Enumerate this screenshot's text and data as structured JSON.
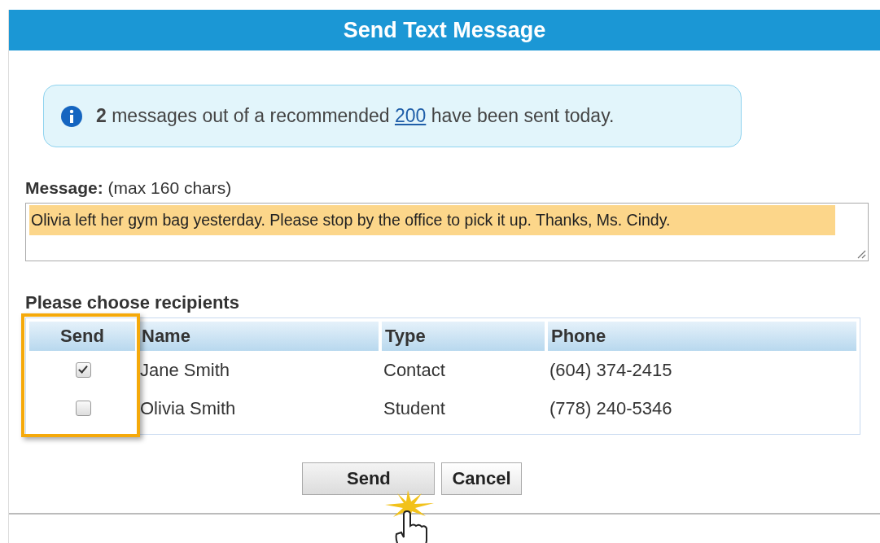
{
  "dialog": {
    "title": "Send Text Message"
  },
  "notice": {
    "before": "**2** messages out of a recommended",
    "link": "200",
    "after": "have been sent today."
  },
  "message": {
    "label": "**Message:** (max 160 chars)",
    "value": "Olivia left her gym bag yesterday. Please stop by the office to pick it up. Thanks, Ms. Cindy.",
    "highlighted": true
  },
  "recipients": {
    "label": "Please choose recipients",
    "send_column_highlighted": true,
    "columns": [
      "Send",
      "Name",
      "Type",
      "Phone"
    ],
    "rows": [
      {
        "checked": true,
        "name": "Jane Smith",
        "type": "Contact",
        "phone": "(604) 374-2415"
      },
      {
        "checked": false,
        "name": "Olivia Smith",
        "type": "Student",
        "phone": "(778) 240-5346"
      }
    ]
  },
  "buttons": [
    {
      "label": "Send",
      "clicked": true
    },
    {
      "label": "Cancel",
      "clicked": false
    }
  ]
}
